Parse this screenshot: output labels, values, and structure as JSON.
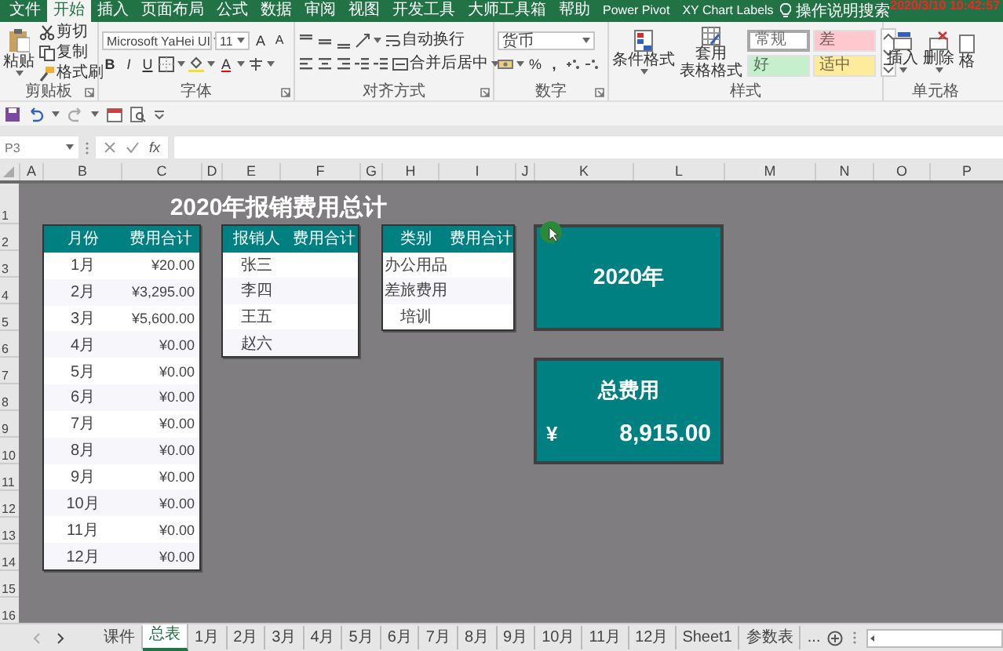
{
  "ribbon_tabs": [
    {
      "label": "文件",
      "selected": false
    },
    {
      "label": "开始",
      "selected": true
    },
    {
      "label": "插入",
      "selected": false
    },
    {
      "label": "页面布局",
      "selected": false
    },
    {
      "label": "公式",
      "selected": false
    },
    {
      "label": "数据",
      "selected": false
    },
    {
      "label": "审阅",
      "selected": false
    },
    {
      "label": "视图",
      "selected": false
    },
    {
      "label": "开发工具",
      "selected": false
    },
    {
      "label": "大师工具箱",
      "selected": false
    },
    {
      "label": "帮助",
      "selected": false
    },
    {
      "label": "Power Pivot",
      "selected": false
    },
    {
      "label": "XY Chart Labels",
      "selected": false
    }
  ],
  "tell_me": "操作说明搜索",
  "clock": "2020/3/10  10:42:57",
  "clipboard": {
    "paste": "粘贴",
    "cut": "剪切",
    "copy": "复制",
    "format_painter": "格式刷",
    "label": "剪贴板"
  },
  "font": {
    "family": "Microsoft YaHei UI",
    "size": "11",
    "grow": "A",
    "shrink": "A",
    "bold": "B",
    "italic": "I",
    "underline": "U",
    "font_color": "A",
    "label": "字体"
  },
  "alignment": {
    "wrap": "自动换行",
    "merge": "合并后居中",
    "label": "对齐方式"
  },
  "number": {
    "format": "货币",
    "percent": "%",
    "comma": ",",
    "label": "数字"
  },
  "styles": {
    "conditional": "条件格式",
    "table_format": [
      "套用",
      "表格格式"
    ],
    "label": "样式",
    "cell_styles": [
      {
        "label": "常规",
        "color": "#ffffff",
        "selected": true
      },
      {
        "label": "差",
        "color": "#ffc7ce",
        "selected": false
      },
      {
        "label": "好",
        "color": "#c6efce",
        "selected": false
      },
      {
        "label": "适中",
        "color": "#ffeb9c",
        "selected": false
      }
    ]
  },
  "cells": {
    "insert": "插入",
    "delete": "删除",
    "format": "格",
    "label": "单元格"
  },
  "name_box": "P3",
  "fx": "fx",
  "column_headers": [
    "A",
    "B",
    "C",
    "D",
    "E",
    "F",
    "G",
    "H",
    "I",
    "J",
    "K",
    "L",
    "M",
    "N",
    "O",
    "P"
  ],
  "row_headers": [
    "1",
    "2",
    "3",
    "4",
    "5",
    "6",
    "7",
    "8",
    "9",
    "10",
    "11",
    "12",
    "13",
    "14",
    "15",
    "16"
  ],
  "sheet": {
    "title": "2020年报销费用总计",
    "monthly_table": {
      "columns": [
        "月份",
        "费用合计"
      ],
      "rows": [
        [
          "1月",
          "¥20.00"
        ],
        [
          "2月",
          "¥3,295.00"
        ],
        [
          "3月",
          "¥5,600.00"
        ],
        [
          "4月",
          "¥0.00"
        ],
        [
          "5月",
          "¥0.00"
        ],
        [
          "6月",
          "¥0.00"
        ],
        [
          "7月",
          "¥0.00"
        ],
        [
          "8月",
          "¥0.00"
        ],
        [
          "9月",
          "¥0.00"
        ],
        [
          "10月",
          "¥0.00"
        ],
        [
          "11月",
          "¥0.00"
        ],
        [
          "12月",
          "¥0.00"
        ]
      ]
    },
    "person_table": {
      "columns": [
        "报销人",
        "费用合计"
      ],
      "rows": [
        [
          "张三"
        ],
        [
          "李四"
        ],
        [
          "王五"
        ],
        [
          "赵六"
        ]
      ]
    },
    "category_table": {
      "columns": [
        "类别",
        "费用合计"
      ],
      "rows": [
        [
          "办公用品"
        ],
        [
          "差旅费用"
        ],
        [
          "培训"
        ]
      ]
    },
    "year_card": {
      "value": "2020年"
    },
    "total_card": {
      "label": "总费用",
      "currency": "¥",
      "value": "8,915.00"
    }
  },
  "sheet_tabs": [
    {
      "label": "课件",
      "selected": false
    },
    {
      "label": "总表",
      "selected": true
    },
    {
      "label": "1月",
      "selected": false
    },
    {
      "label": "2月",
      "selected": false
    },
    {
      "label": "3月",
      "selected": false
    },
    {
      "label": "4月",
      "selected": false
    },
    {
      "label": "5月",
      "selected": false
    },
    {
      "label": "6月",
      "selected": false
    },
    {
      "label": "7月",
      "selected": false
    },
    {
      "label": "8月",
      "selected": false
    },
    {
      "label": "9月",
      "selected": false
    },
    {
      "label": "10月",
      "selected": false
    },
    {
      "label": "11月",
      "selected": false
    },
    {
      "label": "12月",
      "selected": false
    },
    {
      "label": "Sheet1",
      "selected": false
    },
    {
      "label": "参数表",
      "selected": false
    }
  ],
  "more_tabs": "..."
}
